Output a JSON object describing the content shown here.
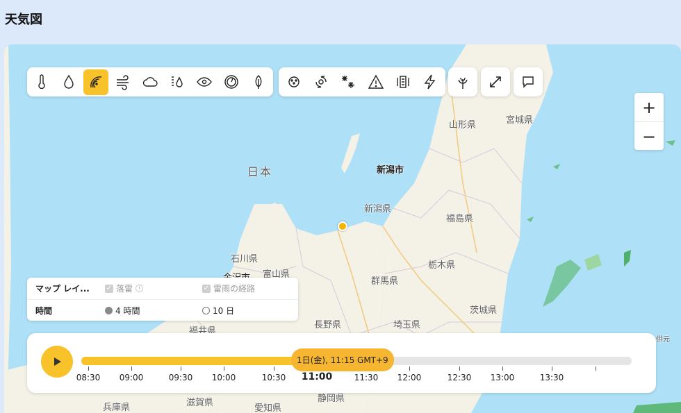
{
  "page": {
    "title": "天気図"
  },
  "map": {
    "labels": {
      "japan": "日本",
      "niigata_city": "新潟市",
      "yamagata": "山形県",
      "miyagi": "宮城県",
      "niigata": "新潟県",
      "fukushima": "福島県",
      "ishikawa": "石川県",
      "kanazawa": "金沢市",
      "toyama": "富山県",
      "tochigi": "栃木県",
      "gunma": "群馬県",
      "ibaraki": "茨城県",
      "nagano": "長野県",
      "saitama": "埼玉県",
      "fukui": "福井県",
      "hyogo": "兵庫県",
      "shiga": "滋賀県",
      "aichi": "愛知県",
      "shizuoka": "静岡県",
      "edge": "供元"
    },
    "colors": {
      "sea": "#aee0f7",
      "land": "#f4f1e6",
      "accent": "#f7c22a",
      "marker": "#f5b400"
    }
  },
  "toolbar": {
    "group1": [
      "thermometer-icon",
      "droplet-icon",
      "radar-icon",
      "wind-icon",
      "cloud-icon",
      "humidity-icon",
      "visibility-eye-icon",
      "pressure-gauge-icon",
      "leaf-icon"
    ],
    "group2": [
      "air-quality-icon",
      "typhoon-icon",
      "snow-icon",
      "warning-icon",
      "heatwave-icon",
      "lightning-icon"
    ],
    "group3": [
      "pollen-icon"
    ],
    "group4": [
      "expand-icon"
    ],
    "group5": [
      "feedback-icon"
    ],
    "active": "radar-icon"
  },
  "zoom": {
    "plus": "+",
    "minus": "−"
  },
  "legend": {
    "map_layer_label": "マップ レイ...",
    "lightning_label": "落雷",
    "storm_path_label": "雷雨の経路",
    "time_label": "時間",
    "option_4h": "4 時間",
    "option_10d": "10 日",
    "selected": "4 時間"
  },
  "timeline": {
    "current_bubble": "1日(金), 11:15 GMT+9",
    "progress": 0.4,
    "labels": [
      "08:30",
      "09:00",
      "09:30",
      "10:00",
      "10:30",
      "11:00",
      "11:30",
      "12:00",
      "12:30",
      "13:00",
      "13:30"
    ],
    "current_label": "11:00"
  }
}
